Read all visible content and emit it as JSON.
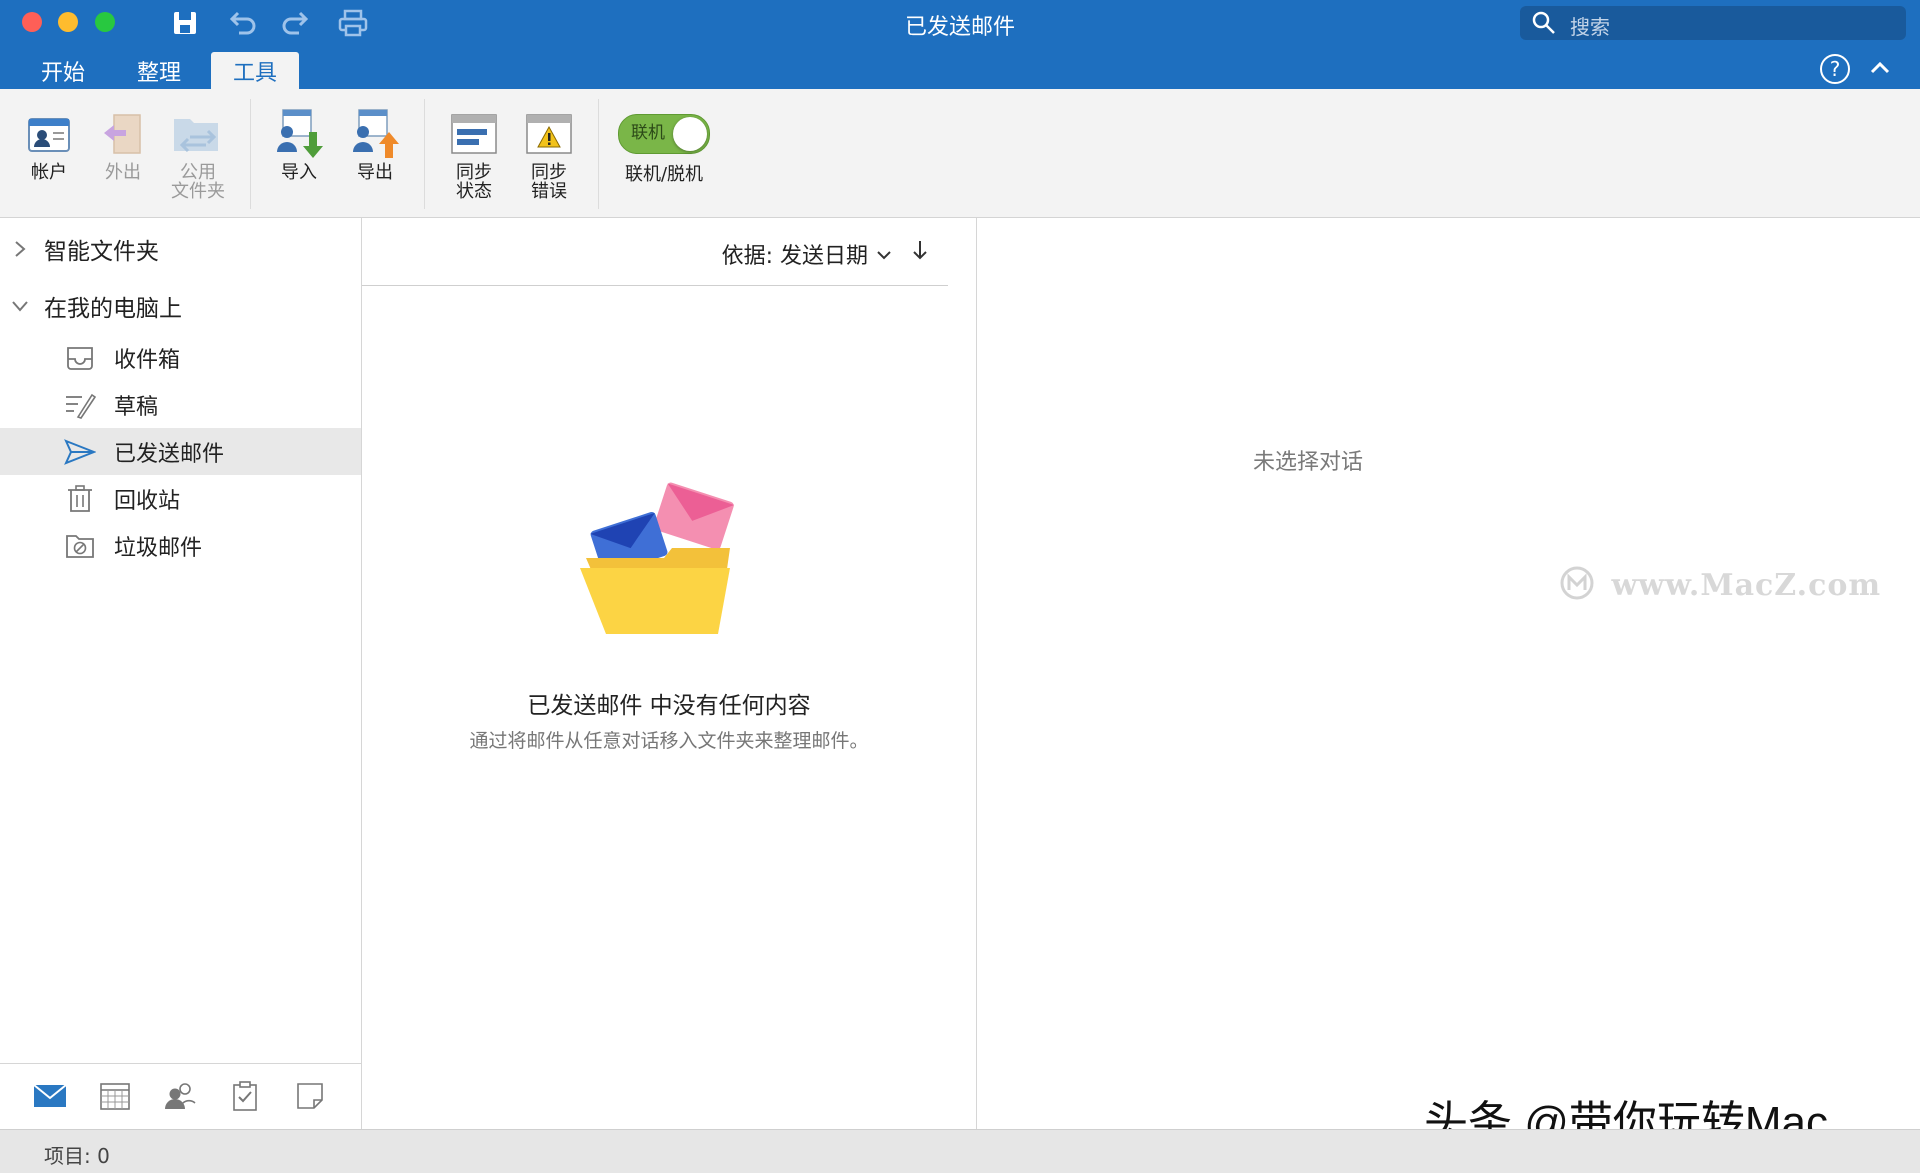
{
  "window": {
    "title": "已发送邮件"
  },
  "search": {
    "placeholder": "搜索"
  },
  "tabs": [
    {
      "label": "开始",
      "active": false
    },
    {
      "label": "整理",
      "active": false
    },
    {
      "label": "工具",
      "active": true
    }
  ],
  "ribbon": {
    "account": "帐户",
    "out": "外出",
    "public_line1": "公用",
    "public_line2": "文件夹",
    "import": "导入",
    "export": "导出",
    "sync_status_line1": "同步",
    "sync_status_line2": "状态",
    "sync_error_line1": "同步",
    "sync_error_line2": "错误",
    "online_toggle_text": "联机",
    "online_offline": "联机/脱机"
  },
  "sidebar": {
    "groups": [
      {
        "label": "智能文件夹",
        "expanded": false
      },
      {
        "label": "在我的电脑上",
        "expanded": true
      }
    ],
    "folders": [
      {
        "label": "收件箱",
        "icon": "inbox-icon"
      },
      {
        "label": "草稿",
        "icon": "drafts-icon"
      },
      {
        "label": "已发送邮件",
        "icon": "sent-icon",
        "selected": true
      },
      {
        "label": "回收站",
        "icon": "trash-icon"
      },
      {
        "label": "垃圾邮件",
        "icon": "junk-icon"
      }
    ]
  },
  "list": {
    "sort_label": "依据: 发送日期",
    "empty_title": "已发送邮件 中没有任何内容",
    "empty_subtitle": "通过将邮件从任意对话移入文件夹来整理邮件。"
  },
  "reading": {
    "no_selection": "未选择对话"
  },
  "watermarks": {
    "site": "www.MacZ.com",
    "author": "头条 @带你玩转Mac"
  },
  "status": {
    "items": "项目: 0"
  },
  "colors": {
    "accent": "#1e6fbf",
    "toggle_on": "#7ab648"
  }
}
